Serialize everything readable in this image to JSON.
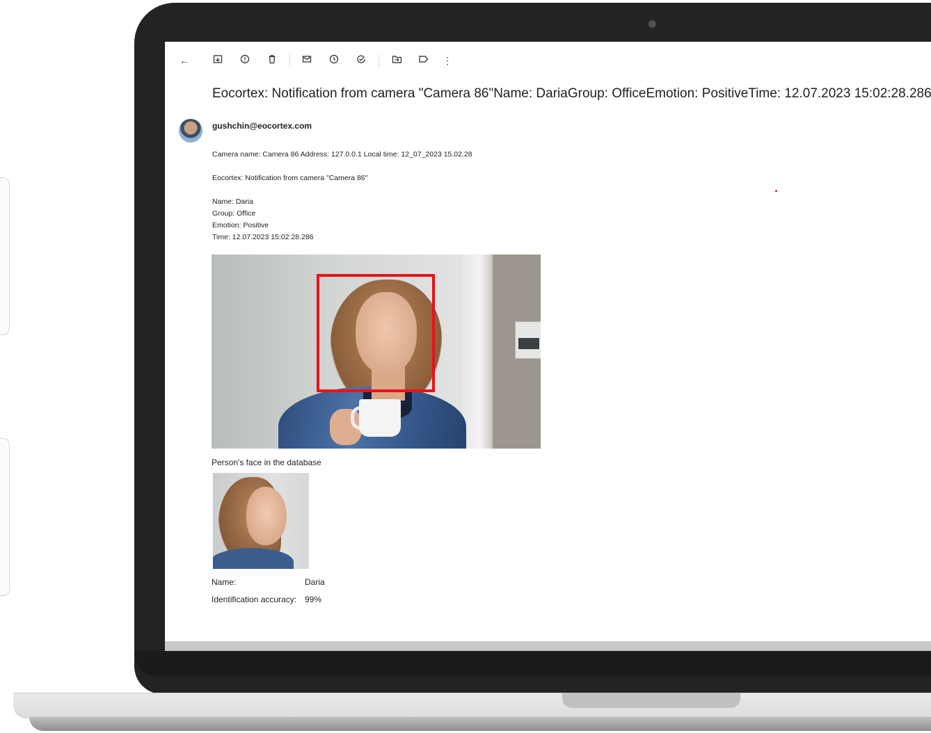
{
  "email": {
    "subject": "Eocortex: Notification from camera \"Camera 86\"Name: DariaGroup: OfficeEmotion: PositiveTime: 12.07.2023 15:02:28.286",
    "sender": "gushchin@eocortex.com",
    "body": {
      "camera_line": "Camera name: Camera 86 Address: 127.0.0.1 Local time: 12_07_2023 15.02.28",
      "notification_line": "Eocortex: Notification from camera \"Camera 86\"",
      "name_line": "Name: Daria",
      "group_line": "Group: Office",
      "emotion_line": "Emotion: Positive",
      "time_line": "Time: 12.07.2023 15:02:28.286"
    },
    "database_caption": "Person's face in the database",
    "info": {
      "name_label": "Name:",
      "name_value": "Daria",
      "accuracy_label": "Identification accuracy:",
      "accuracy_value": "99%"
    }
  },
  "toolbar": {
    "icons": [
      "back-arrow-icon",
      "archive-icon",
      "report-spam-icon",
      "delete-icon",
      "mark-unread-icon",
      "snooze-icon",
      "add-to-tasks-icon",
      "move-to-icon",
      "label-icon",
      "more-options-icon"
    ]
  },
  "colors": {
    "bounding_box": "#e5141b",
    "laptop_bezel": "#232323"
  }
}
